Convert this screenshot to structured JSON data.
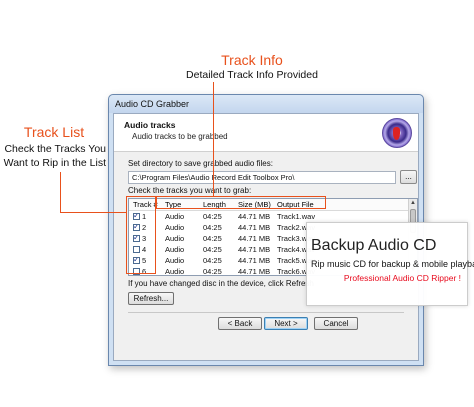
{
  "callouts": {
    "track_info_title": "Track Info",
    "track_info_desc": "Detailed Track Info Provided",
    "track_list_title": "Track List",
    "track_list_desc_1": "Check the Tracks You",
    "track_list_desc_2": "Want to Rip in the List"
  },
  "window": {
    "title": "Audio CD Grabber",
    "header_title": "Audio tracks",
    "header_subtitle": "Audio tracks to be grabbed",
    "dir_label": "Set directory to save grabbed audio files:",
    "dir_value": "C:\\Program Files\\Audio Record Edit Toolbox Pro\\",
    "browse_label": "...",
    "check_label": "Check the tracks you want to grab:",
    "columns": [
      "Track #",
      "Type",
      "Length",
      "Size (MB)",
      "Output File"
    ],
    "tracks": [
      {
        "num": "1",
        "type": "Audio",
        "length": "04:25",
        "size": "44.71 MB",
        "file": "Track1.wav",
        "checked": true
      },
      {
        "num": "2",
        "type": "Audio",
        "length": "04:25",
        "size": "44.71 MB",
        "file": "Track2.wav",
        "checked": true
      },
      {
        "num": "3",
        "type": "Audio",
        "length": "04:25",
        "size": "44.71 MB",
        "file": "Track3.wav",
        "checked": true
      },
      {
        "num": "4",
        "type": "Audio",
        "length": "04:25",
        "size": "44.71 MB",
        "file": "Track4.wav",
        "checked": false
      },
      {
        "num": "5",
        "type": "Audio",
        "length": "04:25",
        "size": "44.71 MB",
        "file": "Track5.wav",
        "checked": true
      },
      {
        "num": "6",
        "type": "Audio",
        "length": "04:25",
        "size": "44.71 MB",
        "file": "Track6.wav",
        "checked": false
      }
    ],
    "refresh_note": "If you have changed disc in the device, click Refresh",
    "refresh_button": "Refresh...",
    "back_button": "< Back",
    "next_button": "Next >",
    "cancel_button": "Cancel"
  },
  "overlay": {
    "title": "Backup Audio CD",
    "desc": "Rip music CD for backup & mobile playback",
    "tagline": "Professional Audio CD Ripper !"
  },
  "colors": {
    "accent": "#e8511c",
    "tagline": "#e8091c"
  }
}
